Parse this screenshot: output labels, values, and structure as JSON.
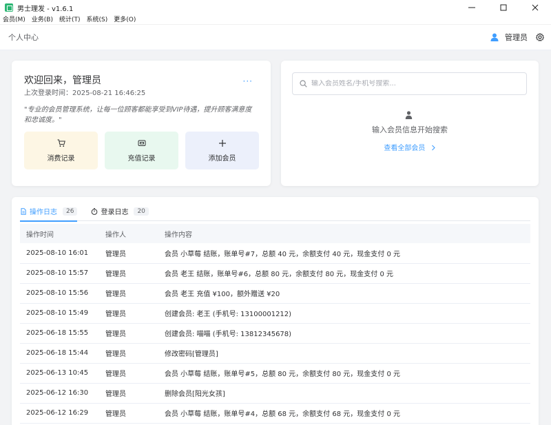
{
  "window": {
    "title": "男士理发 - v1.6.1"
  },
  "menubar": [
    {
      "label": "会员(M)"
    },
    {
      "label": "业务(B)"
    },
    {
      "label": "统计(T)"
    },
    {
      "label": "系统(S)"
    },
    {
      "label": "更多(O)"
    }
  ],
  "header": {
    "breadcrumb": "个人中心",
    "user_name": "管理员"
  },
  "welcome": {
    "title": "欢迎回来，管理员",
    "last_login": "上次登录时间：2025-08-21 16:46:25",
    "more": "···",
    "quote": "\"专业的会员管理系统，让每一位顾客都能享受到VIP待遇，提升顾客满意度和忠诚度。\"",
    "actions": [
      {
        "label": "消费记录",
        "icon": "cart-icon"
      },
      {
        "label": "充值记录",
        "icon": "wallet-icon"
      },
      {
        "label": "添加会员",
        "icon": "plus-icon"
      }
    ]
  },
  "search": {
    "placeholder": "输入会员姓名/手机号搜索...",
    "empty_text": "输入会员信息开始搜索",
    "view_all": "查看全部会员"
  },
  "logs": {
    "tabs": [
      {
        "label": "操作日志",
        "count": "26",
        "active": true
      },
      {
        "label": "登录日志",
        "count": "20",
        "active": false
      }
    ],
    "columns": [
      "操作时间",
      "操作人",
      "操作内容"
    ],
    "rows": [
      [
        "2025-08-10 16:01",
        "管理员",
        "会员 小草莓 结账，账单号#7，总额 40 元，余额支付 40 元，现金支付 0 元"
      ],
      [
        "2025-08-10 15:57",
        "管理员",
        "会员 老王 结账，账单号#6，总额 80 元，余额支付 80 元，现金支付 0 元"
      ],
      [
        "2025-08-10 15:56",
        "管理员",
        "会员 老王 充值 ¥100，额外赠送 ¥20"
      ],
      [
        "2025-08-10 15:49",
        "管理员",
        "创建会员: 老王 (手机号: 13100001212)"
      ],
      [
        "2025-06-18 15:55",
        "管理员",
        "创建会员: 喵喵 (手机号: 13812345678)"
      ],
      [
        "2025-06-18 15:44",
        "管理员",
        "修改密码[管理员]"
      ],
      [
        "2025-06-13 10:45",
        "管理员",
        "会员 小草莓 结账，账单号#5，总额 80 元，余额支付 80 元，现金支付 0 元"
      ],
      [
        "2025-06-12 16:30",
        "管理员",
        "删除会员[阳光女孩]"
      ],
      [
        "2025-06-12 16:29",
        "管理员",
        "会员 小草莓 结账，账单号#4，总额 68 元，余额支付 68 元，现金支付 0 元"
      ]
    ]
  },
  "colors": {
    "accent": "#409eff",
    "brand": "#2bb673"
  }
}
